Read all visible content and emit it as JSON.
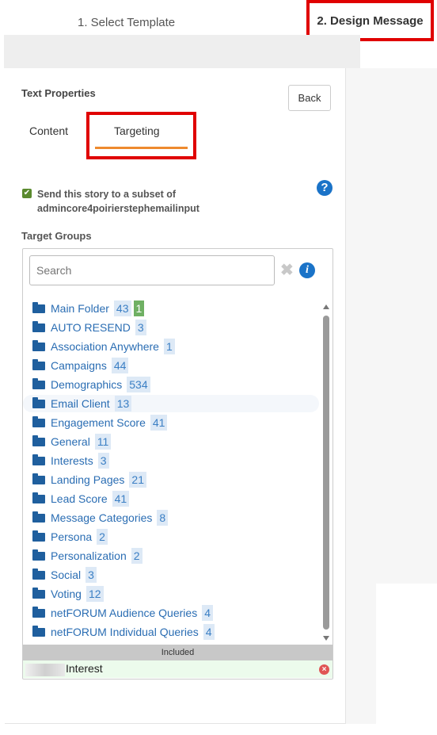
{
  "steps": {
    "step1": "1. Select Template",
    "step2": "2. Design Message"
  },
  "panel": {
    "title": "Text Properties",
    "back_label": "Back",
    "tabs": {
      "content": "Content",
      "targeting": "Targeting"
    },
    "subset_line1": "Send this story to a subset of",
    "subset_line2": "admincore4poirierstephemailinput",
    "help_glyph": "?",
    "target_groups_label": "Target Groups",
    "search_placeholder": "Search",
    "clear_glyph": "✖",
    "info_glyph": "i",
    "folders": [
      {
        "name": "Main Folder",
        "count": "43",
        "extra": "1"
      },
      {
        "name": "AUTO RESEND",
        "count": "3"
      },
      {
        "name": "Association Anywhere",
        "count": "1"
      },
      {
        "name": "Campaigns",
        "count": "44"
      },
      {
        "name": "Demographics",
        "count": "534"
      },
      {
        "name": "Email Client",
        "count": "13"
      },
      {
        "name": "Engagement Score",
        "count": "41"
      },
      {
        "name": "General",
        "count": "11"
      },
      {
        "name": "Interests",
        "count": "3"
      },
      {
        "name": "Landing Pages",
        "count": "21"
      },
      {
        "name": "Lead Score",
        "count": "41"
      },
      {
        "name": "Message Categories",
        "count": "8"
      },
      {
        "name": "Persona",
        "count": "2"
      },
      {
        "name": "Personalization",
        "count": "2"
      },
      {
        "name": "Social",
        "count": "3"
      },
      {
        "name": "Voting",
        "count": "12"
      },
      {
        "name": "netFORUM Audience Queries",
        "count": "4"
      },
      {
        "name": "netFORUM Individual Queries",
        "count": "4"
      }
    ],
    "included_label": "Included",
    "included_item": "Interest",
    "remove_glyph": "×"
  },
  "colors": {
    "accent_tab": "#ee8a2f",
    "highlight_box": "#e00000",
    "link_blue": "#2a6db3",
    "checkbox_green": "#5a8a2e"
  }
}
